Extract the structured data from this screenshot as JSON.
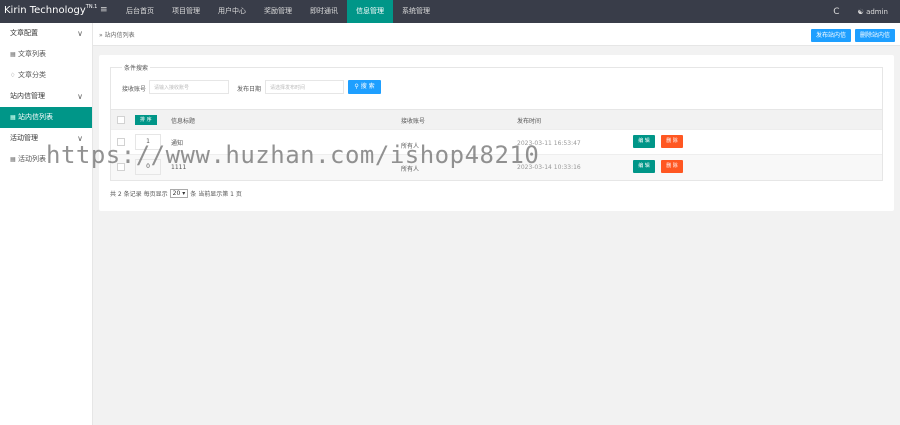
{
  "header": {
    "logo": "Kirin Technology",
    "logo_sup": "TN.1",
    "menu_icon": "≡",
    "nav": [
      "后台首页",
      "项目管理",
      "用户中心",
      "奖励管理",
      "即时通讯",
      "信息管理",
      "系统管理"
    ],
    "active_nav": "信息管理",
    "refresh_icon": "C",
    "user_icon": "user-icon",
    "username": "admin"
  },
  "sidebar": {
    "items": [
      {
        "label": "文章配置",
        "chevron": "∨"
      },
      {
        "label": "文章列表",
        "icon": "list-icon"
      },
      {
        "label": "文章分类",
        "icon": "tag-icon"
      },
      {
        "label": "站内信管理",
        "chevron": "∨"
      },
      {
        "label": "站内信列表",
        "icon": "list-icon"
      },
      {
        "label": "活动管理",
        "chevron": "∨"
      },
      {
        "label": "活动列表",
        "icon": "list-icon"
      }
    ]
  },
  "breadcrumb": "站内信列表",
  "header_buttons": {
    "publish": "发布站内信",
    "delete": "删除站内信"
  },
  "filter": {
    "legend": "条件搜索",
    "account_label": "接收账号",
    "account_placeholder": "请输入接收账号",
    "date_label": "发布日期",
    "date_placeholder": "请选择发布时间",
    "search_label": "搜 索"
  },
  "table": {
    "sort_label": "排 序",
    "columns": [
      "信息标题",
      "接收账号",
      "发布时间"
    ],
    "rows": [
      {
        "id": "1",
        "title": "通知",
        "account": "所有人",
        "time": "2023-03-11 16:53:47"
      },
      {
        "id": "0",
        "title": "1111",
        "account": "所有人",
        "time": "2023-03-14 10:33:16"
      }
    ],
    "edit_label": "编 辑",
    "delete_label": "删 除"
  },
  "pager": {
    "total_text": "共 2 条记录",
    "per_page_label": "每页显示",
    "per_page": "20",
    "per_page_suffix": "条",
    "page_info": "当前显示第 1 页"
  },
  "watermark": "https://www.huzhan.com/ishop48210",
  "colors": {
    "topbar": "#393d49",
    "accent": "#009688",
    "primary_button": "#1e9fff",
    "danger": "#ff5722"
  }
}
